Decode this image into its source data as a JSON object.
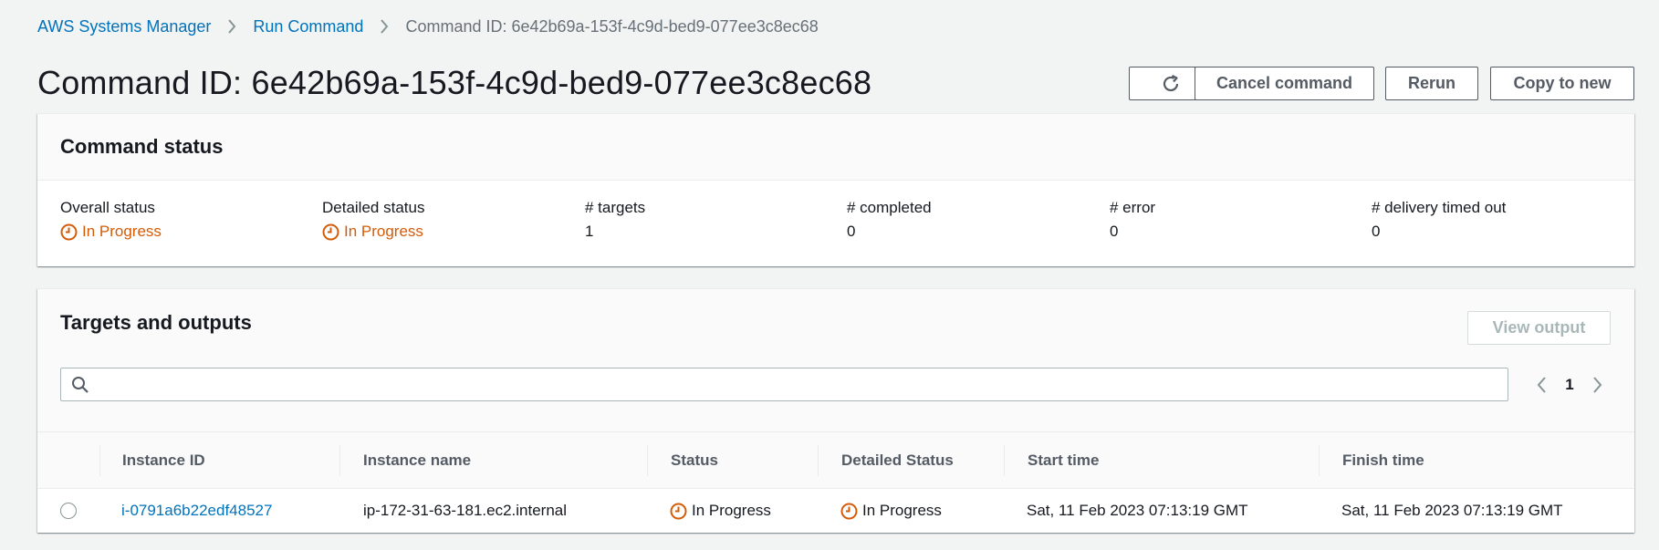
{
  "breadcrumb": {
    "root": "AWS Systems Manager",
    "parent": "Run Command",
    "current": "Command ID: 6e42b69a-153f-4c9d-bed9-077ee3c8ec68"
  },
  "page_title": "Command ID: 6e42b69a-153f-4c9d-bed9-077ee3c8ec68",
  "actions": {
    "refresh_icon": "refresh-icon",
    "cancel": "Cancel command",
    "rerun": "Rerun",
    "copy": "Copy to new"
  },
  "status_panel": {
    "title": "Command status",
    "overall_label": "Overall status",
    "overall_value": "In Progress",
    "detailed_label": "Detailed status",
    "detailed_value": "In Progress",
    "targets_label": "# targets",
    "targets_value": "1",
    "completed_label": "# completed",
    "completed_value": "0",
    "error_label": "# error",
    "error_value": "0",
    "timedout_label": "# delivery timed out",
    "timedout_value": "0"
  },
  "targets_panel": {
    "title": "Targets and outputs",
    "view_output": "View output",
    "search_placeholder": "",
    "page": "1",
    "columns": {
      "instance_id": "Instance ID",
      "instance_name": "Instance name",
      "status": "Status",
      "detailed_status": "Detailed Status",
      "start_time": "Start time",
      "finish_time": "Finish time"
    },
    "rows": [
      {
        "instance_id": "i-0791a6b22edf48527",
        "instance_name": "ip-172-31-63-181.ec2.internal",
        "status": "In Progress",
        "detailed_status": "In Progress",
        "start_time": "Sat, 11 Feb 2023 07:13:19 GMT",
        "finish_time": "Sat, 11 Feb 2023 07:13:19 GMT"
      }
    ]
  },
  "colors": {
    "link": "#0073bb",
    "in_progress": "#d45b07",
    "text": "#16191f",
    "background": "#f2f3f3"
  }
}
